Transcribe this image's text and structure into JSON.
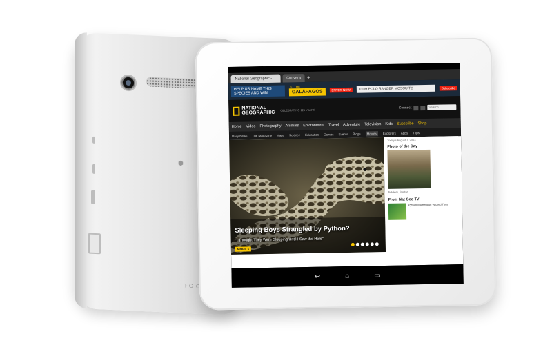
{
  "scene": {
    "background": "#ffffff",
    "device_color": "#f2f2f2"
  },
  "back": {
    "marks": "FC CE"
  },
  "browser": {
    "status": "",
    "tabs": [
      {
        "label": "National Geographic - ...",
        "active": true
      },
      {
        "label": "Convera",
        "active": false
      }
    ],
    "new_tab": "+"
  },
  "ad": {
    "left": "HELP US NAME THIS SPECIES AND WIN",
    "to_the": "TO THE",
    "galapagos": "GALÁPAGOS",
    "enter": "ENTER NOW",
    "right": "FILM POLO RANGER MOSQUITO",
    "subscribe": "Subscribe"
  },
  "header": {
    "logo_text": "NATIONAL GEOGRAPHIC",
    "tagline": "CELEBRATING 125 YEARS",
    "search_label": "Connect",
    "search_placeholder": "Search"
  },
  "mainnav": [
    "Home",
    "Video",
    "Photography",
    "Animals",
    "Environment",
    "Travel",
    "Adventure",
    "Television",
    "Kids",
    "Subscribe",
    "Shop"
  ],
  "subnav": [
    "Daily News",
    "The Magazine",
    "Maps",
    "Science",
    "Education",
    "Games",
    "Events",
    "Blogs",
    "Movies",
    "Explorers",
    "Apps",
    "Trips"
  ],
  "hero": {
    "title": "Sleeping Boys Strangled by Python?",
    "subtitle": "\"I Thought They Were Sleeping Until I Saw the Hole\"",
    "more": "MORE »",
    "slides": 6,
    "active_slide": 0
  },
  "sidebar": {
    "date": "Today's August 7, 2013",
    "photo_heading": "Photo of the Day",
    "photo_caption": "Soldiers, Bhutan",
    "tv_heading": "From Nat Geo TV",
    "tv_text": "Python Moment on Wicked Tuna"
  },
  "android_nav": {
    "back": "↩",
    "home": "⌂",
    "recents": "▭"
  }
}
